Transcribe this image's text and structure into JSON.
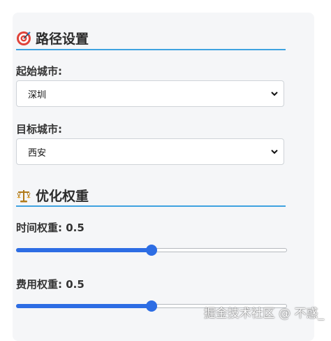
{
  "route_settings": {
    "icon": "target-icon",
    "title": "路径设置",
    "start_city_label": "起始城市:",
    "start_city_value": "深圳",
    "end_city_label": "目标城市:",
    "end_city_value": "西安"
  },
  "optimization_weights": {
    "icon": "balance-scale-icon",
    "title": "优化权重",
    "time_label": "时间权重: 0.5",
    "time_value": 0.5,
    "cost_label": "费用权重: 0.5",
    "cost_value": 0.5
  },
  "watermark": "掘金技术社区 @ 不惑_",
  "colors": {
    "accent": "#2d6de4",
    "rule": "#3fa3e0",
    "panel_bg": "#f5f6f8"
  }
}
